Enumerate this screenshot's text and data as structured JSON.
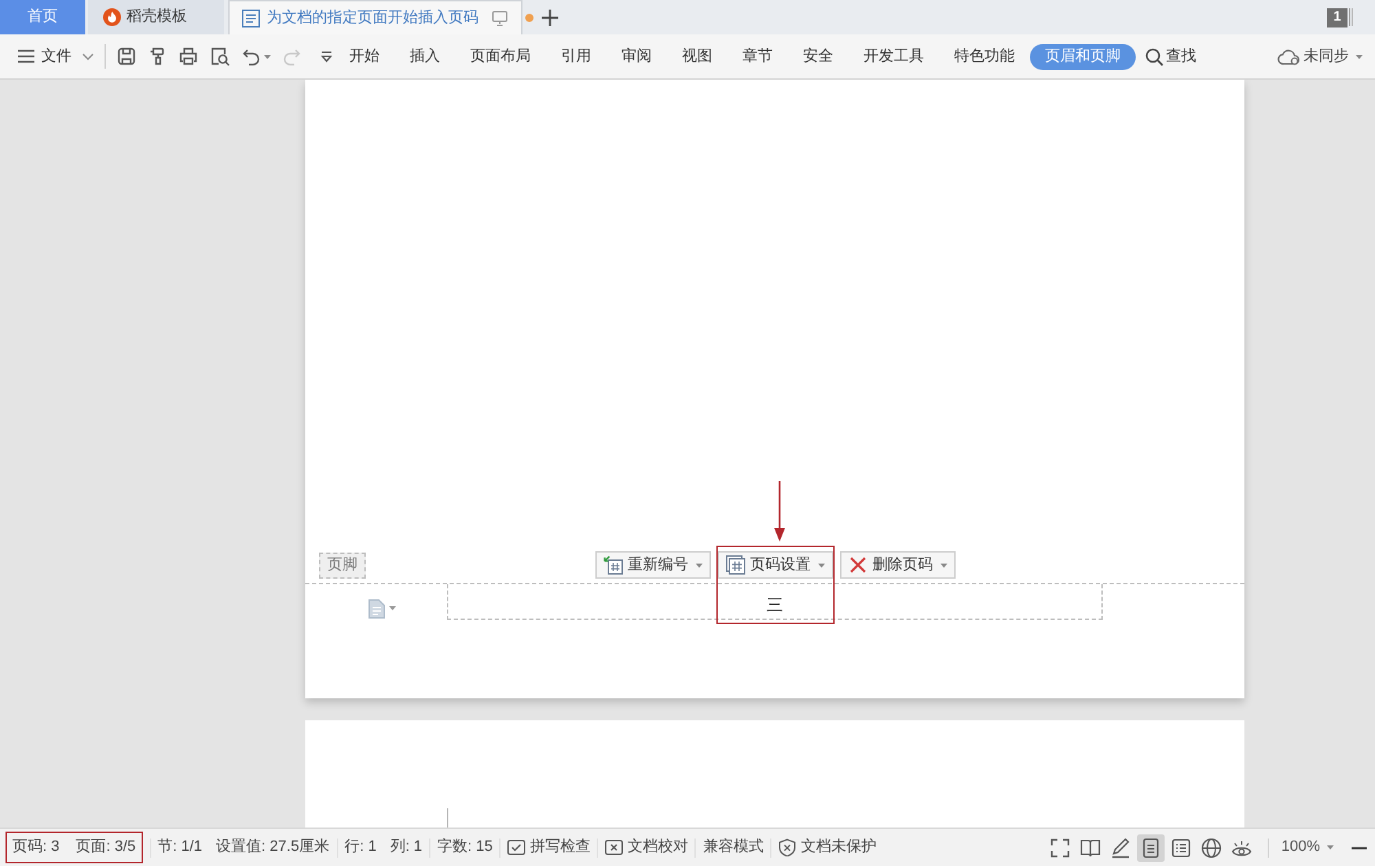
{
  "tabs": [
    {
      "label": "首页",
      "kind": "home",
      "selected": false,
      "modified": false
    },
    {
      "label": "稻壳模板",
      "kind": "template",
      "selected": false,
      "modified": false
    },
    {
      "label": "为文档的指定页面开始插入页码",
      "kind": "document",
      "selected": true,
      "modified": true
    }
  ],
  "window_count": "1",
  "toolbar": {
    "file_menu": "文件",
    "quick_actions": [
      {
        "kind": "save",
        "disabled": false
      },
      {
        "kind": "format_painter",
        "disabled": false
      },
      {
        "kind": "print",
        "disabled": false
      },
      {
        "kind": "print_preview",
        "disabled": false
      },
      {
        "kind": "undo",
        "disabled": false
      },
      {
        "kind": "redo",
        "disabled": true
      },
      {
        "kind": "customize",
        "disabled": false
      }
    ],
    "ribbon_tabs": [
      {
        "label": "开始",
        "selected": false
      },
      {
        "label": "插入",
        "selected": false
      },
      {
        "label": "页面布局",
        "selected": false
      },
      {
        "label": "引用",
        "selected": false
      },
      {
        "label": "审阅",
        "selected": false
      },
      {
        "label": "视图",
        "selected": false
      },
      {
        "label": "章节",
        "selected": false
      },
      {
        "label": "安全",
        "selected": false
      },
      {
        "label": "开发工具",
        "selected": false
      },
      {
        "label": "特色功能",
        "selected": false
      },
      {
        "label": "页眉和页脚",
        "selected": true
      }
    ],
    "search": "查找",
    "sync": "未同步"
  },
  "document": {
    "footer": {
      "label": "页脚",
      "buttons": [
        {
          "label": "重新编号",
          "kind": "renumber",
          "highlighted": false
        },
        {
          "label": "页码设置",
          "kind": "page_number_settings",
          "highlighted": true
        },
        {
          "label": "删除页码",
          "kind": "delete",
          "highlighted": false
        }
      ],
      "page_number": "三"
    }
  },
  "status_bar": {
    "groups": [
      {
        "highlighted": true,
        "items": [
          {
            "kind": "text",
            "label": "页码: 3"
          },
          {
            "kind": "text",
            "label": "页面: 3/5"
          }
        ]
      },
      {
        "highlighted": false,
        "items": [
          {
            "kind": "text",
            "label": "节: 1/1"
          },
          {
            "kind": "text",
            "label": "设置值: 27.5厘米"
          }
        ]
      },
      {
        "highlighted": false,
        "items": [
          {
            "kind": "text",
            "label": "行: 1"
          },
          {
            "kind": "text",
            "label": "列: 1"
          }
        ]
      },
      {
        "highlighted": false,
        "items": [
          {
            "kind": "text",
            "label": "字数: 15"
          }
        ]
      },
      {
        "highlighted": false,
        "items": [
          {
            "kind": "spellcheck",
            "label": "拼写检查"
          }
        ]
      },
      {
        "highlighted": false,
        "items": [
          {
            "kind": "proofread",
            "label": "文档校对"
          }
        ]
      },
      {
        "highlighted": false,
        "items": [
          {
            "kind": "text",
            "label": "兼容模式"
          }
        ]
      },
      {
        "highlighted": false,
        "items": [
          {
            "kind": "protection",
            "label": "文档未保护"
          }
        ]
      }
    ],
    "view_modes": [
      {
        "kind": "fullscreen",
        "selected": false
      },
      {
        "kind": "reading",
        "selected": false
      },
      {
        "kind": "writing",
        "selected": false
      },
      {
        "kind": "page",
        "selected": true
      },
      {
        "kind": "outline",
        "selected": false
      },
      {
        "kind": "web",
        "selected": false
      },
      {
        "kind": "eye_care",
        "selected": false
      }
    ],
    "zoom": "100%"
  }
}
